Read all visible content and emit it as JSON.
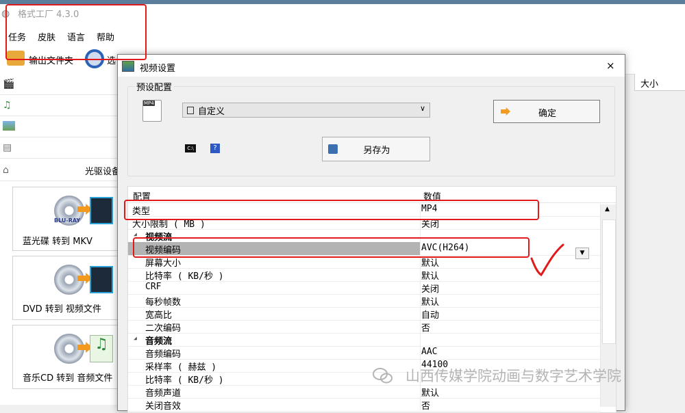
{
  "app": {
    "title": "格式工厂 4.3.0"
  },
  "menu": [
    "任务",
    "皮肤",
    "语言",
    "帮助"
  ],
  "toolbar": {
    "output_folder": "输出文件夹",
    "options_partial": "选"
  },
  "left_panel": {
    "optical_label": "光驱设备",
    "tiles": [
      {
        "label": "蓝光碟 转到 MKV",
        "disc_text": "BLU-RAY"
      },
      {
        "label": "DVD 转到 视频文件"
      },
      {
        "label": "音乐CD 转到 音频文件"
      }
    ]
  },
  "list_header": {
    "size": "大小"
  },
  "dialog": {
    "title": "视频设置",
    "close": "×",
    "preset_group_label": "预设配置",
    "preset_select": "自定义",
    "ok_button": "确定",
    "saveas_button": "另存为",
    "icons": {
      "mp4": "MP4",
      "cmd": "C:\\",
      "help": "?"
    },
    "grid": {
      "col_setting": "配置",
      "col_value": "数值",
      "rows": [
        {
          "name": "类型",
          "value": "MP4",
          "kind": "normal"
        },
        {
          "name": "大小限制 ( MB )",
          "value": "关闭",
          "kind": "normal"
        },
        {
          "name": "视频流",
          "value": "",
          "kind": "section"
        },
        {
          "name": "视频编码",
          "value": "AVC(H264)",
          "kind": "selected"
        },
        {
          "name": "屏幕大小",
          "value": "默认",
          "kind": "normal"
        },
        {
          "name": "比特率 ( KB/秒 )",
          "value": "默认",
          "kind": "normal"
        },
        {
          "name": "CRF",
          "value": "关闭",
          "kind": "normal"
        },
        {
          "name": "每秒帧数",
          "value": "默认",
          "kind": "normal"
        },
        {
          "name": "宽高比",
          "value": "自动",
          "kind": "normal"
        },
        {
          "name": "二次编码",
          "value": "否",
          "kind": "normal"
        },
        {
          "name": "音频流",
          "value": "",
          "kind": "section"
        },
        {
          "name": "音频编码",
          "value": "AAC",
          "kind": "normal"
        },
        {
          "name": "采样率 ( 赫兹 )",
          "value": "44100",
          "kind": "normal"
        },
        {
          "name": "比特率 ( KB/秒 )",
          "value": "",
          "kind": "normal"
        },
        {
          "name": "音频声道",
          "value": "默认",
          "kind": "normal"
        },
        {
          "name": "关闭音效",
          "value": "否",
          "kind": "normal"
        }
      ]
    }
  },
  "watermark": "山西传媒学院动画与数字艺术学院",
  "annotation_color": "#e01a1a"
}
